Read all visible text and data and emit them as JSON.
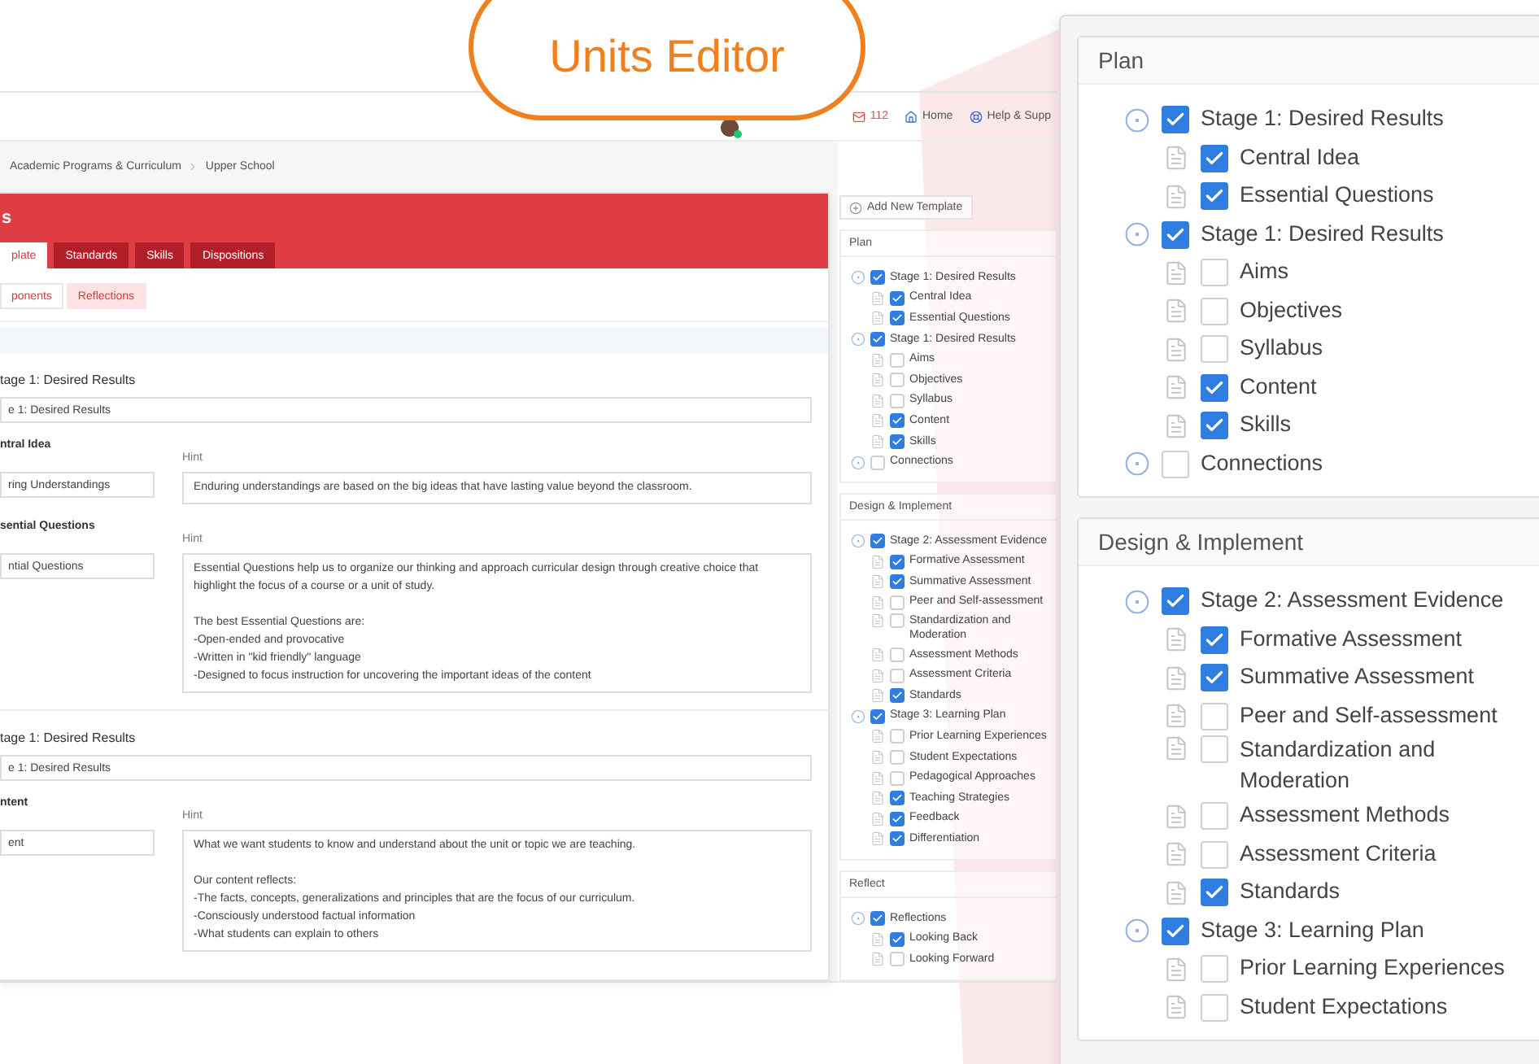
{
  "callout": {
    "label": "Units Editor"
  },
  "topbar": {
    "nav": [
      {
        "kind": "mail",
        "label": "112"
      },
      {
        "kind": "home",
        "label": "Home"
      },
      {
        "kind": "help",
        "label": "Help & Supp"
      }
    ]
  },
  "breadcrumb": [
    "Academic Programs & Curriculum",
    "Upper School"
  ],
  "header": {
    "title": "s",
    "tabs": [
      {
        "label": "plate",
        "selected": true
      },
      {
        "label": "Standards",
        "selected": false
      },
      {
        "label": "Skills",
        "selected": false
      },
      {
        "label": "Dispositions",
        "selected": false
      }
    ]
  },
  "subtabs": [
    {
      "label": "ponents",
      "selected": true
    },
    {
      "label": "Reflections",
      "selected": false
    }
  ],
  "sections": [
    {
      "heading": "tage 1: Desired Results",
      "value": "e 1: Desired Results",
      "fields": [
        {
          "label": "ntral Idea",
          "hint_label": "Hint",
          "value": "ring Understandings",
          "hint": "Enduring understandings are based on the big ideas that have lasting value beyond the classroom."
        },
        {
          "label": "sential Questions",
          "hint_label": "Hint",
          "value": "ntial Questions",
          "hint": "Essential Questions help us to organize our thinking and approach curricular design through creative choice that highlight the focus of a course or a unit of study.\n\nThe best Essential Questions are:\n-Open-ended and provocative\n-Written in \"kid friendly\" language\n-Designed to focus instruction for uncovering the important ideas of the content"
        }
      ]
    },
    {
      "heading": "tage 1: Desired Results",
      "value": "e 1: Desired Results",
      "fields": [
        {
          "label": "ntent",
          "hint_label": "Hint",
          "value": "ent",
          "hint": "What we want students to know and understand about the unit or topic we are teaching.\n\nOur content reflects:\n-The facts, concepts, generalizations and principles that are the focus of our curriculum.\n-Consciously understood factual information\n-What students can explain to others"
        }
      ]
    }
  ],
  "sidebar": {
    "add_button": "Add New Template",
    "groups": [
      {
        "title": "Plan",
        "items": [
          {
            "label": "Stage 1: Desired Results",
            "checked": true,
            "children": [
              {
                "label": "Central Idea",
                "checked": true
              },
              {
                "label": "Essential Questions",
                "checked": true
              }
            ]
          },
          {
            "label": "Stage 1: Desired Results",
            "checked": true,
            "children": [
              {
                "label": "Aims",
                "checked": false
              },
              {
                "label": "Objectives",
                "checked": false
              },
              {
                "label": "Syllabus",
                "checked": false
              },
              {
                "label": "Content",
                "checked": true
              },
              {
                "label": "Skills",
                "checked": true
              }
            ]
          },
          {
            "label": "Connections",
            "checked": false
          }
        ]
      },
      {
        "title": "Design & Implement",
        "items": [
          {
            "label": "Stage 2: Assessment Evidence",
            "checked": true,
            "children": [
              {
                "label": "Formative Assessment",
                "checked": true
              },
              {
                "label": "Summative Assessment",
                "checked": true
              },
              {
                "label": "Peer and Self-assessment",
                "checked": false
              },
              {
                "label": "Standardization and\nModeration",
                "checked": false
              },
              {
                "label": "Assessment Methods",
                "checked": false
              },
              {
                "label": "Assessment Criteria",
                "checked": false
              },
              {
                "label": "Standards",
                "checked": true
              }
            ]
          },
          {
            "label": "Stage 3: Learning Plan",
            "checked": true,
            "children": [
              {
                "label": "Prior Learning Experiences",
                "checked": false
              },
              {
                "label": "Student Expectations",
                "checked": false
              },
              {
                "label": "Pedagogical Approaches",
                "checked": false
              },
              {
                "label": "Teaching Strategies",
                "checked": true
              },
              {
                "label": "Feedback",
                "checked": true
              },
              {
                "label": "Differentiation",
                "checked": true
              }
            ]
          }
        ]
      },
      {
        "title": "Reflect",
        "items": [
          {
            "label": "Reflections",
            "checked": true,
            "children": [
              {
                "label": "Looking Back",
                "checked": true
              },
              {
                "label": "Looking Forward",
                "checked": false
              }
            ]
          }
        ]
      }
    ]
  },
  "zoom_panel": {
    "groups": [
      {
        "title": "Plan",
        "items": [
          {
            "label": "Stage 1: Desired Results",
            "checked": true,
            "children": [
              {
                "label": "Central Idea",
                "checked": true
              },
              {
                "label": "Essential Questions",
                "checked": true
              }
            ]
          },
          {
            "label": "Stage 1: Desired Results",
            "checked": true,
            "children": [
              {
                "label": "Aims",
                "checked": false
              },
              {
                "label": "Objectives",
                "checked": false
              },
              {
                "label": "Syllabus",
                "checked": false
              },
              {
                "label": "Content",
                "checked": true
              },
              {
                "label": "Skills",
                "checked": true
              }
            ]
          },
          {
            "label": "Connections",
            "checked": false
          }
        ]
      },
      {
        "title": "Design & Implement",
        "items": [
          {
            "label": "Stage 2: Assessment Evidence",
            "checked": true,
            "children": [
              {
                "label": "Formative Assessment",
                "checked": true
              },
              {
                "label": "Summative Assessment",
                "checked": true
              },
              {
                "label": "Peer and Self-assessment",
                "checked": false
              },
              {
                "label": "Standardization and\nModeration",
                "checked": false
              },
              {
                "label": "Assessment Methods",
                "checked": false
              },
              {
                "label": "Assessment Criteria",
                "checked": false
              },
              {
                "label": "Standards",
                "checked": true
              }
            ]
          },
          {
            "label": "Stage 3: Learning Plan",
            "checked": true,
            "children": [
              {
                "label": "Prior Learning Experiences",
                "checked": false
              },
              {
                "label": "Student Expectations",
                "checked": false
              }
            ]
          }
        ]
      }
    ]
  }
}
